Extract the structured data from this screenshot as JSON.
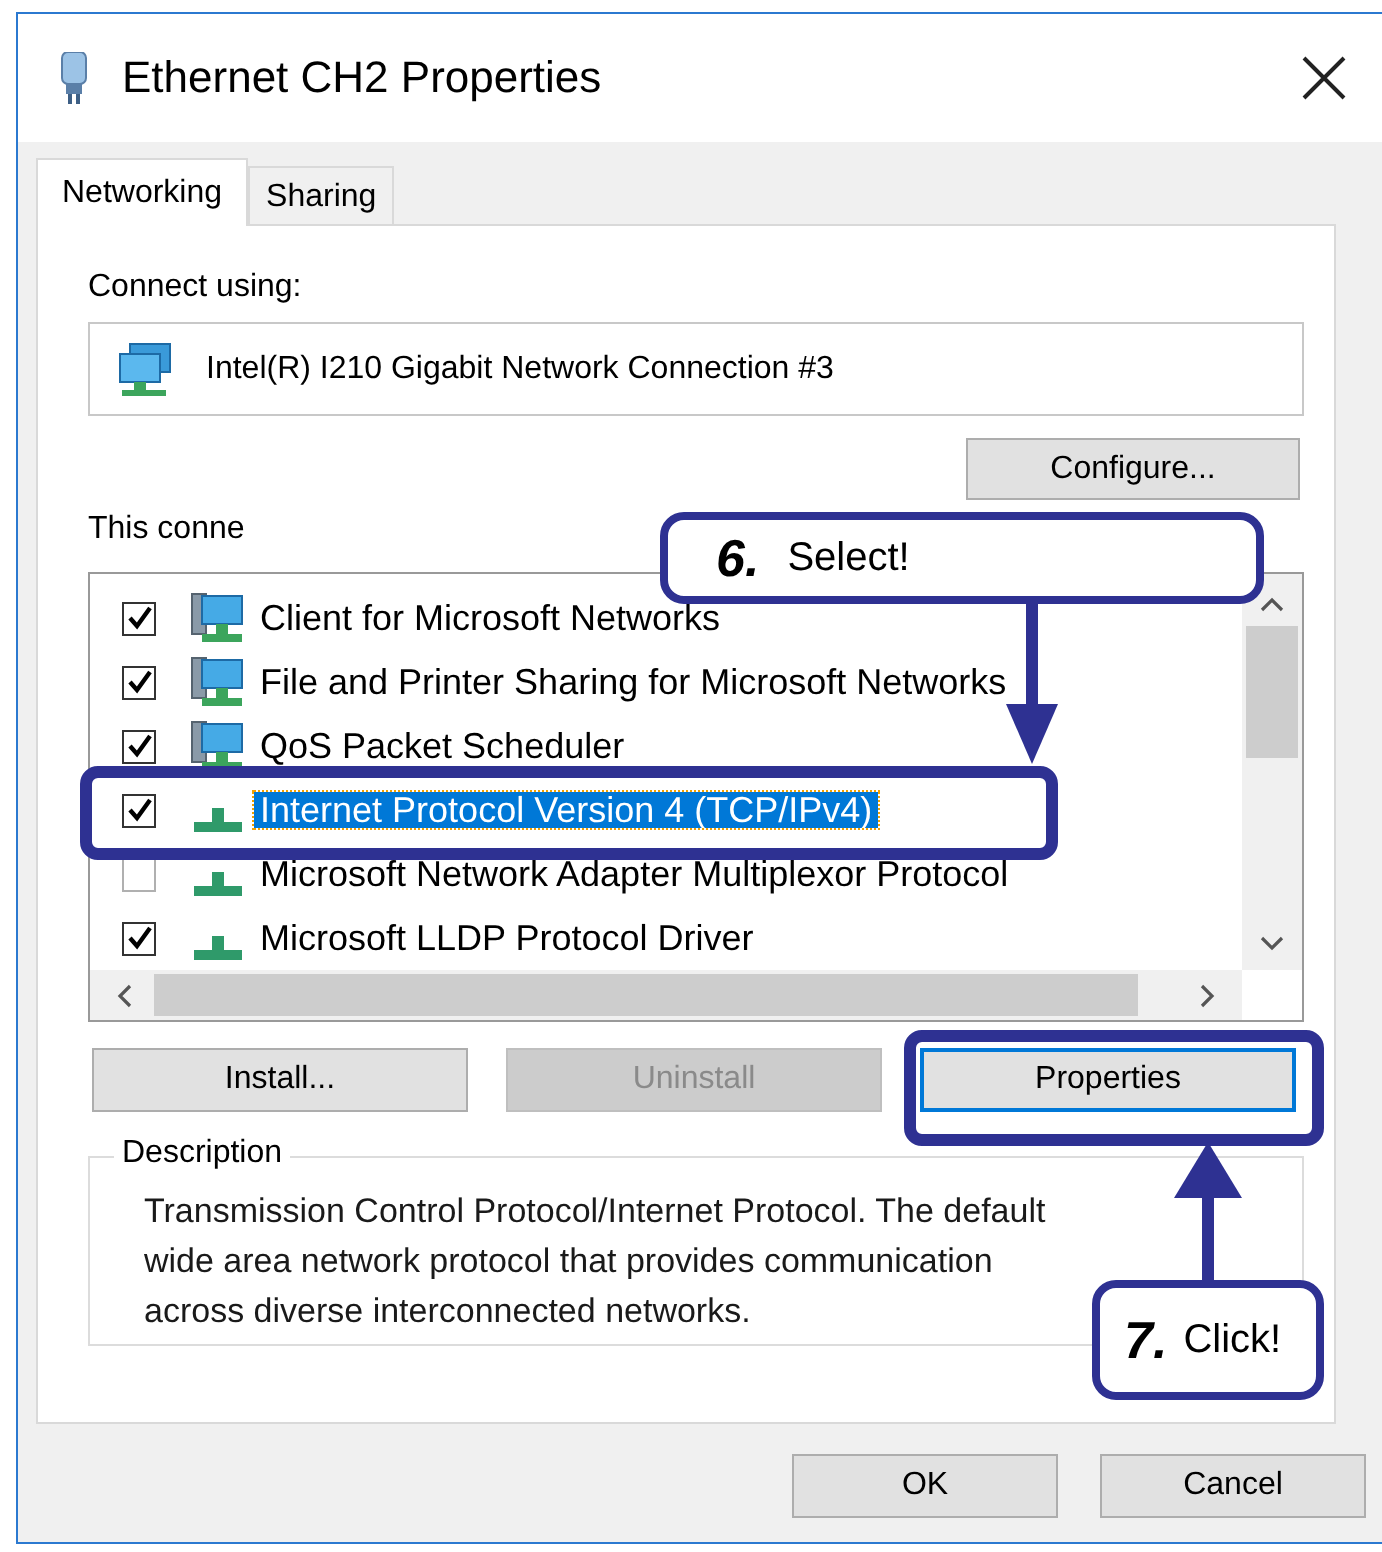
{
  "window": {
    "title": "Ethernet CH2 Properties"
  },
  "tabs": [
    {
      "label": "Networking",
      "selected": true
    },
    {
      "label": "Sharing",
      "selected": false
    }
  ],
  "connect_using": {
    "label": "Connect using:",
    "adapter": "Intel(R) I210 Gigabit Network Connection #3",
    "button": "Configure..."
  },
  "components": {
    "label": "This conne",
    "items": [
      {
        "label": "Client for Microsoft Networks",
        "checked": true,
        "selected": false,
        "kind": "client"
      },
      {
        "label": "File and Printer Sharing for Microsoft Networks",
        "checked": true,
        "selected": false,
        "kind": "client"
      },
      {
        "label": "QoS Packet Scheduler",
        "checked": true,
        "selected": false,
        "kind": "client"
      },
      {
        "label": "Internet Protocol Version 4 (TCP/IPv4)",
        "checked": true,
        "selected": true,
        "kind": "protocol"
      },
      {
        "label": "Microsoft Network Adapter Multiplexor Protocol",
        "checked": false,
        "selected": false,
        "kind": "protocol"
      },
      {
        "label": "Microsoft LLDP Protocol Driver",
        "checked": true,
        "selected": false,
        "kind": "protocol"
      }
    ]
  },
  "buttons": [
    {
      "label": "Install...",
      "disabled": false,
      "focused": false
    },
    {
      "label": "Uninstall",
      "disabled": true,
      "focused": false
    },
    {
      "label": "Properties",
      "disabled": false,
      "focused": true
    }
  ],
  "description": {
    "legend": "Description",
    "text": "Transmission Control Protocol/Internet Protocol. The default wide area network protocol that provides communication across diverse interconnected networks."
  },
  "dialog_buttons": [
    "OK",
    "Cancel"
  ],
  "callouts": [
    {
      "step": "6.",
      "text": "Select!"
    },
    {
      "step": "7.",
      "text": "Click!"
    }
  ]
}
